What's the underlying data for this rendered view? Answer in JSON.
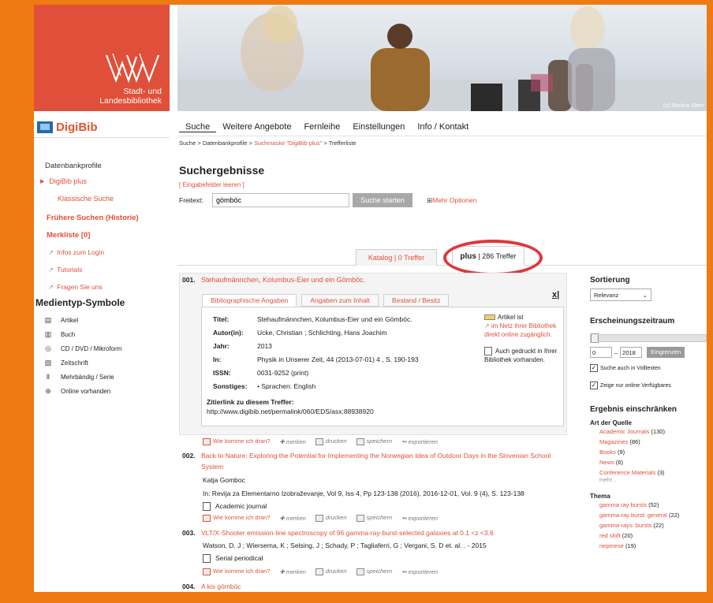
{
  "logo": {
    "line1": "Stadt- und",
    "line2": "Landesbibliothek"
  },
  "banner": {
    "credit": "(c) Markus Stein"
  },
  "brand": {
    "name": "DigiBib"
  },
  "topnav": [
    "Suche",
    "Weitere Angebote",
    "Fernleihe",
    "Einstellungen",
    "Info / Kontakt"
  ],
  "breadcrumb": {
    "part1": "Suche > Datenbankprofile > ",
    "part2": "Suchmaske \"DigiBib plus\" ",
    "part3": "> Trefferliste"
  },
  "sidebar": {
    "profiles_heading": "Datenbankprofile",
    "digibib_plus": "DigiBib plus",
    "classic_search": "Klassische Suche",
    "history": "Frühere Suchen (Historie)",
    "watchlist": "Merkliste [0]",
    "links": [
      "Infos zum Login",
      "Tutorials",
      "Fragen Sie uns"
    ],
    "media_title": "Medientyp-Symbole",
    "media": [
      {
        "icon": "article-icon",
        "glyph": "▤",
        "label": "Artikel"
      },
      {
        "icon": "book-icon",
        "glyph": "▥",
        "label": "Buch"
      },
      {
        "icon": "cd-icon",
        "glyph": "◎",
        "label": "CD / DVD / Mikroform"
      },
      {
        "icon": "journal-icon",
        "glyph": "▧",
        "label": "Zeitschrift"
      },
      {
        "icon": "multivolume-icon",
        "glyph": "Ⅱ",
        "label": "Mehrbändig / Serie"
      },
      {
        "icon": "online-icon",
        "glyph": "⊕",
        "label": "Online vorhanden"
      }
    ]
  },
  "main": {
    "title": "Suchergebnisse",
    "reset": "[ Eingabefelder leeren ]",
    "freitext_label": "Freitext:",
    "search_value": "gömböc",
    "search_button": "Suche starten",
    "more_options": "Mehr Optionen",
    "more_options_mark": "⊞"
  },
  "tabs": {
    "katalog": "Katalog | 0 Treffer",
    "plus_bold": "plus",
    "plus_rest": " | 286 Treffer"
  },
  "result1": {
    "num": "001.",
    "title": "Stehaufmännchen, Kolumbus-Eier und ein Gömböc.",
    "close": "x|",
    "tabs": [
      "Bibliographische Angaben",
      "Angaben zum Inhalt",
      "Bestand / Besitz"
    ],
    "fields": [
      {
        "key": "Titel:",
        "val": "Stehaufmännchen, Kolumbus-Eier und ein Gömböc."
      },
      {
        "key": "Autor(in):",
        "val": "Ucke, Christian ; Schlichting, Hans Joachim"
      },
      {
        "key": "Jahr:",
        "val": "2013"
      },
      {
        "key": "In:",
        "val": "Physik in Unserer Zeit, 44 (2013-07-01) 4 , S. 190-193"
      },
      {
        "key": "ISSN:",
        "val": "0031-9252 (print)"
      },
      {
        "key": "Sonstiges:",
        "val": "•  Sprachen: English"
      }
    ],
    "zitier_label": "Zitierlink zu diesem Treffer:",
    "zitier_url": " http://www.digibib.net/permalink/060/EDS/asx:88938920",
    "avail1": "Artikel ist",
    "avail2": "im Netz ihrer Bibliothek direkt online zugänglich.",
    "avail3": "Auch gedruckt in Ihrer Bibliothek vorhanden."
  },
  "actions": {
    "wie": "Wie komme ich dran?",
    "merken": "merken",
    "drucken": "drucken",
    "speichern": "speichern",
    "export": "exportieren"
  },
  "result2": {
    "num": "002.",
    "title": "Back to Nature: Exploring the Potential for Implementing the Norwegian Idea of Outdoor Days in the Slovenian School System",
    "author": "Katja Gomboc",
    "source": "In: Revija za Elementarno Izobraževanje, Vol 9, Iss 4, Pp 123-138 (2016), 2016-12-01, Vol. 9 (4), S. 123-138",
    "type": "Academic journal"
  },
  "result3": {
    "num": "003.",
    "title": "VLT/X-Shooter emission-line spectroscopy of 96 gamma-ray-burst-selected galaxies at 0.1 <z <3.6",
    "author": "Watson, D. J ; Wiersema, K ; Selsing, J ; Schady, P ; Tagliaferri, G ; Vergani, S. D et. al. . - 2015",
    "type": "Serial periodical"
  },
  "result4": {
    "num": "004.",
    "title": "A kis gömböc"
  },
  "right": {
    "sort_title": "Sortierung",
    "sort_value": "Relevanz",
    "period_title": "Erscheinungszeitraum",
    "from": "0",
    "dash": "–",
    "to": "2018",
    "limit_button": "Eingrenzen",
    "check1": "Suche auch in Volltexten",
    "check2": "Zeige nur online Verfügbares",
    "restrict_title": "Ergebnis einschränken",
    "source_label": "Art der Quelle",
    "sources": [
      {
        "name": "Academic Journals",
        "count": " (130)"
      },
      {
        "name": "Magazines",
        "count": " (86)"
      },
      {
        "name": "Books",
        "count": " (9)"
      },
      {
        "name": "News",
        "count": " (6)"
      },
      {
        "name": "Conference Materials",
        "count": " (3)"
      }
    ],
    "more": "mehr...",
    "topic_label": "Thema",
    "topics": [
      {
        "name": "gamma ray bursts",
        "count": " (52)"
      },
      {
        "name": "gamma-ray burst: general",
        "count": " (22)"
      },
      {
        "name": "gamma-rays: bursts",
        "count": " (22)"
      },
      {
        "name": "red shift",
        "count": " (20)"
      },
      {
        "name": "nepmese",
        "count": " (19)"
      }
    ]
  }
}
